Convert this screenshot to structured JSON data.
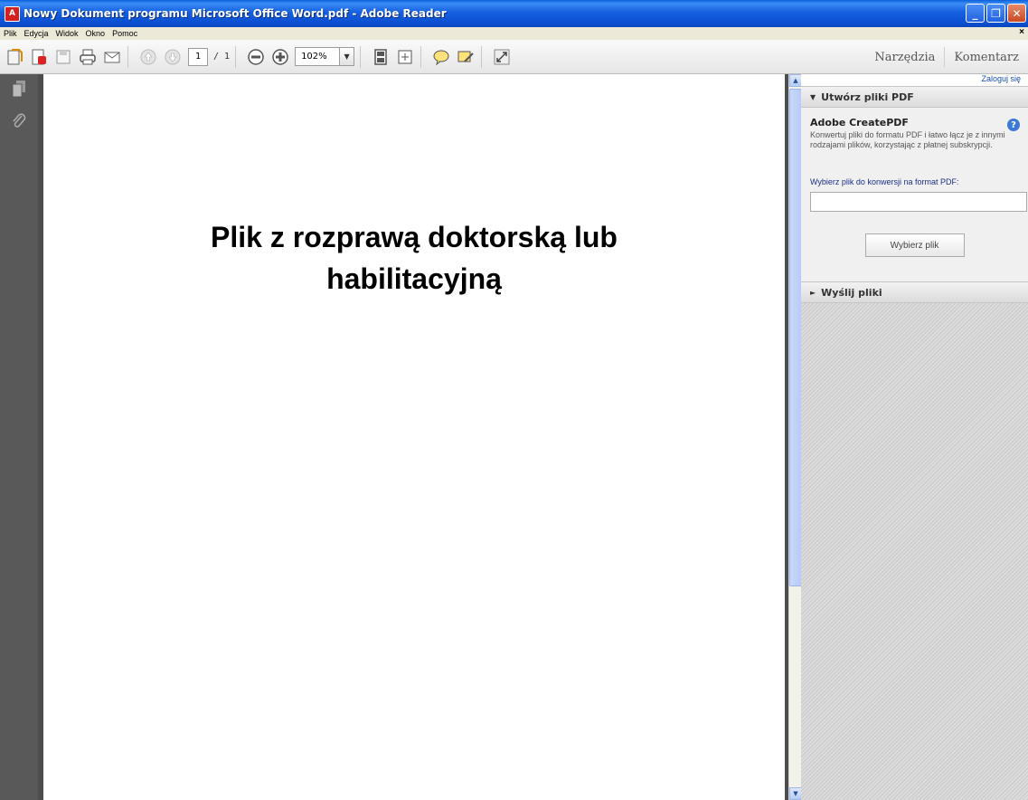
{
  "window": {
    "app_icon": "pdf-app-icon",
    "title": "Nowy Dokument programu Microsoft Office Word.pdf - Adobe Reader",
    "buttons": {
      "minimize": "minimize-icon",
      "restore": "restore-icon",
      "close": "close-icon"
    }
  },
  "menu": {
    "items": [
      "Plik",
      "Edycja",
      "Widok",
      "Okno",
      "Pomoc"
    ],
    "close_glyph": "×"
  },
  "toolbar": {
    "page_current": "1",
    "page_total": "/ 1",
    "zoom": "102%",
    "right_links": [
      "Narzędzia",
      "Komentarz"
    ]
  },
  "document": {
    "heading": "Plik z rozprawą doktorską lub habilitacyjną"
  },
  "right_panel": {
    "login_link": "Zaloguj się",
    "create_section": {
      "header": "Utwórz pliki PDF",
      "service_title": "Adobe CreatePDF",
      "description": "Konwertuj pliki do formatu PDF i łatwo łącz je z innymi rodzajami plików, korzystając z płatnej subskrypcji.",
      "choose_label": "Wybierz plik do konwersji na format PDF:",
      "file_value": "",
      "choose_button": "Wybierz plik"
    },
    "send_section": {
      "header": "Wyślij pliki"
    }
  },
  "colors": {
    "titlebar": "#0b4fd1",
    "sidebar": "#595959",
    "link": "#1c4fb0"
  }
}
